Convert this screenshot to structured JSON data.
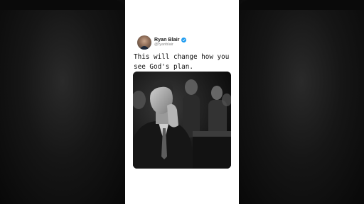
{
  "tweet": {
    "author": {
      "display_name": "Ryan Blair",
      "handle": "@ryanblair",
      "verified": true,
      "avatar_icon": "profile-photo"
    },
    "text": "This will change how you\nsee God's plan.",
    "media": {
      "type": "photo",
      "style": "black-and-white"
    }
  },
  "colors": {
    "verified_badge": "#1d9bf0",
    "card_background": "#ffffff",
    "side_background": "#111111"
  }
}
